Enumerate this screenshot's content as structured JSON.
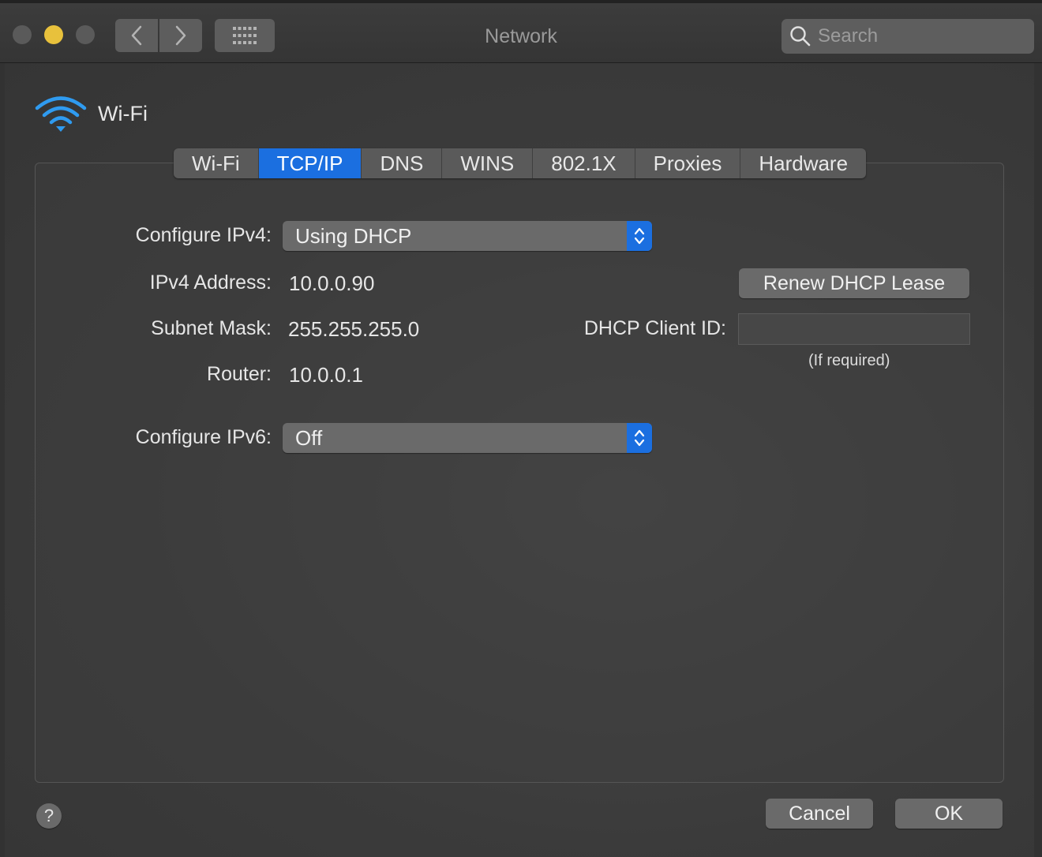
{
  "window": {
    "title": "Network"
  },
  "search": {
    "placeholder": "Search"
  },
  "header": {
    "label": "Wi-Fi"
  },
  "tabs": [
    {
      "label": "Wi-Fi"
    },
    {
      "label": "TCP/IP"
    },
    {
      "label": "DNS"
    },
    {
      "label": "WINS"
    },
    {
      "label": "802.1X"
    },
    {
      "label": "Proxies"
    },
    {
      "label": "Hardware"
    }
  ],
  "active_tab": "TCP/IP",
  "tcpip": {
    "configure_ipv4_label": "Configure IPv4:",
    "configure_ipv4_value": "Using DHCP",
    "ipv4_address_label": "IPv4 Address:",
    "ipv4_address_value": "10.0.0.90",
    "subnet_mask_label": "Subnet Mask:",
    "subnet_mask_value": "255.255.255.0",
    "router_label": "Router:",
    "router_value": "10.0.0.1",
    "configure_ipv6_label": "Configure IPv6:",
    "configure_ipv6_value": "Off",
    "renew_button": "Renew DHCP Lease",
    "dhcp_client_id_label": "DHCP Client ID:",
    "dhcp_client_id_value": "",
    "dhcp_client_id_hint": "(If required)"
  },
  "footer": {
    "help": "?",
    "cancel": "Cancel",
    "ok": "OK"
  },
  "colors": {
    "accent": "#1b6fe0",
    "minimize": "#e8c13c",
    "wifi_icon": "#2f9bf0"
  }
}
